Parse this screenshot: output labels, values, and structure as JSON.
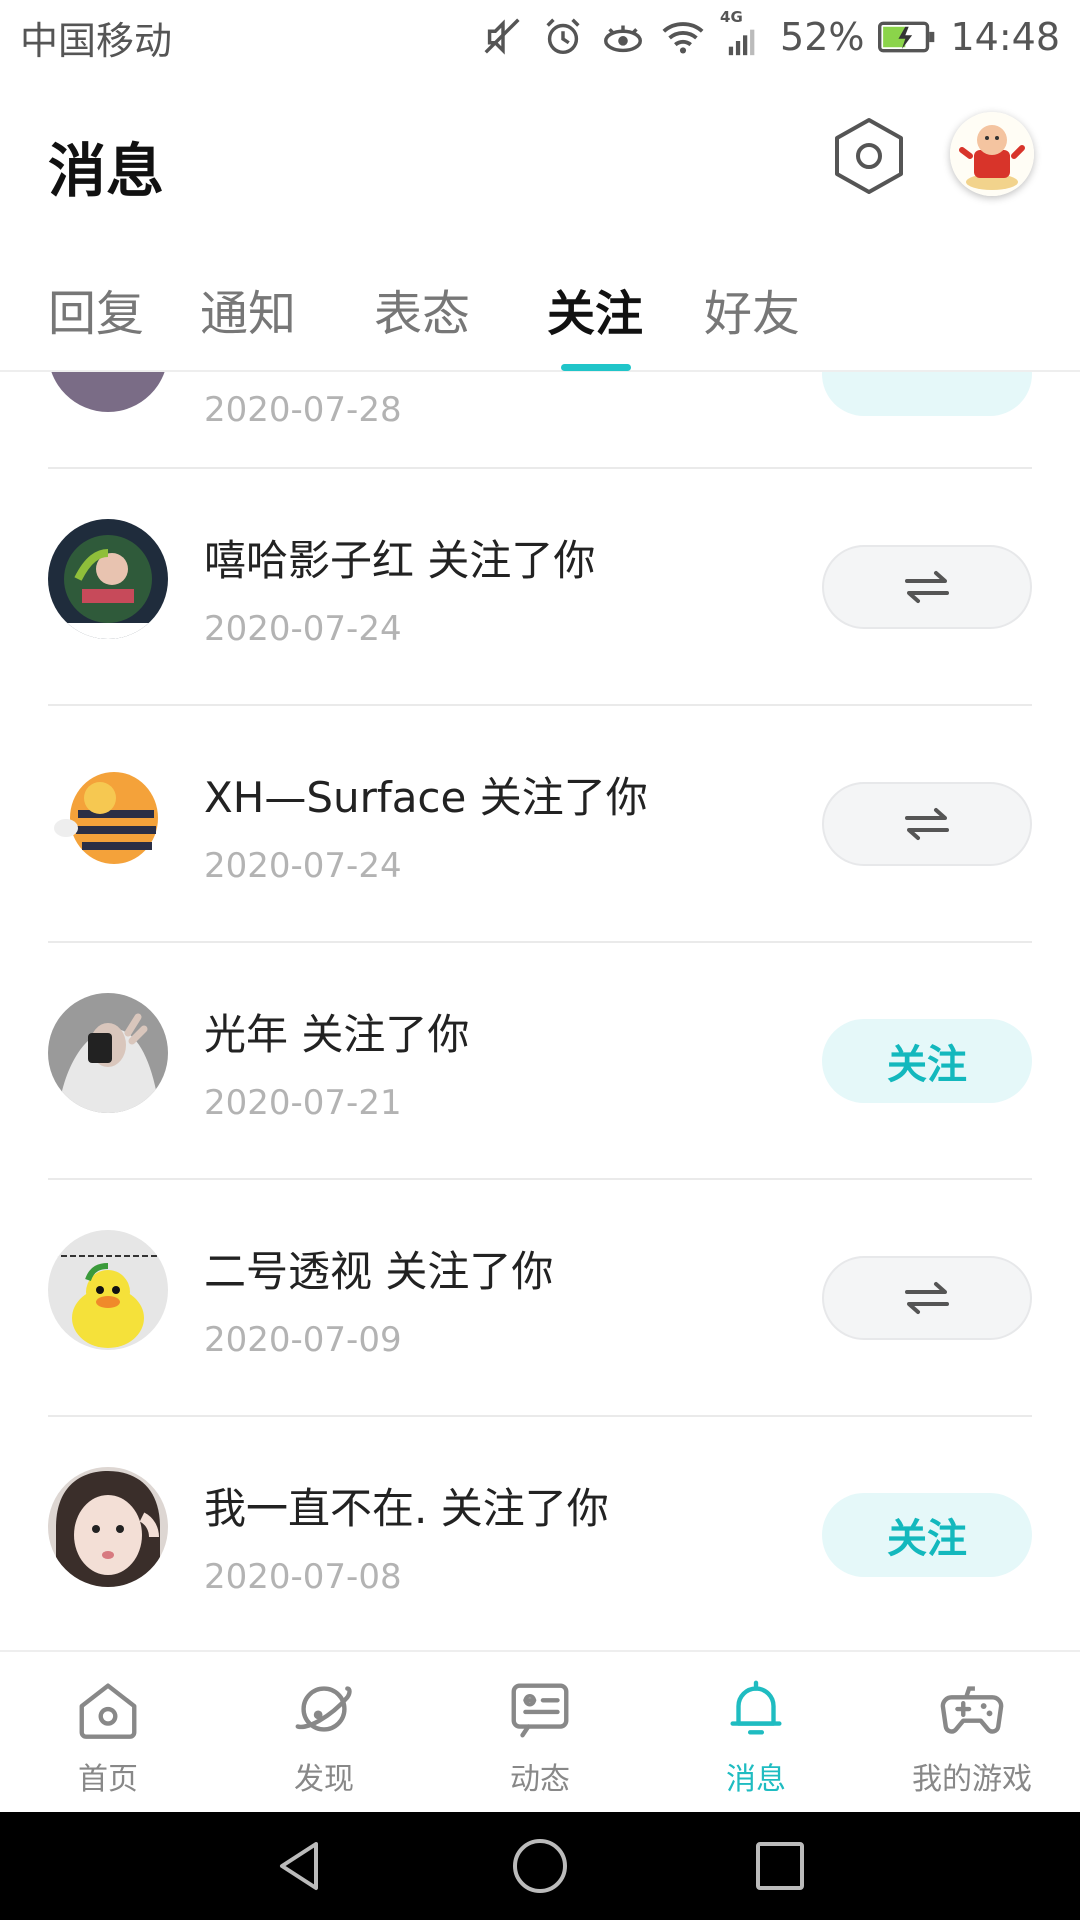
{
  "status_bar": {
    "carrier": "中国移动",
    "network": "4G",
    "battery": "52%",
    "time": "14:48"
  },
  "header": {
    "title": "消息"
  },
  "tabs": [
    {
      "label": "回复",
      "active": false
    },
    {
      "label": "通知",
      "active": false
    },
    {
      "label": "表态",
      "active": false
    },
    {
      "label": "关注",
      "active": true
    },
    {
      "label": "好友",
      "active": false
    }
  ],
  "list": {
    "partial_item": {
      "date": "2020-07-28"
    },
    "items": [
      {
        "name": "嘻哈影子红 关注了你",
        "date": "2020-07-24",
        "action": "mutual",
        "action_icon": "swap-arrows-icon"
      },
      {
        "name": "XH—Surface 关注了你",
        "date": "2020-07-24",
        "action": "mutual",
        "action_icon": "swap-arrows-icon"
      },
      {
        "name": "光年 关注了你",
        "date": "2020-07-21",
        "action": "follow",
        "action_label": "关注"
      },
      {
        "name": "二号透视 关注了你",
        "date": "2020-07-09",
        "action": "mutual",
        "action_icon": "swap-arrows-icon"
      },
      {
        "name": "我一直不在. 关注了你",
        "date": "2020-07-08",
        "action": "follow",
        "action_label": "关注"
      }
    ]
  },
  "bottom_nav": [
    {
      "label": "首页",
      "icon": "home-icon",
      "active": false
    },
    {
      "label": "发现",
      "icon": "planet-icon",
      "active": false
    },
    {
      "label": "动态",
      "icon": "chat-card-icon",
      "active": false
    },
    {
      "label": "消息",
      "icon": "bell-icon",
      "active": true
    },
    {
      "label": "我的游戏",
      "icon": "gamepad-icon",
      "active": false
    }
  ],
  "colors": {
    "accent": "#1fbcc1",
    "follow_bg": "#e5f8f9",
    "date_gray": "#b3b3b3"
  }
}
